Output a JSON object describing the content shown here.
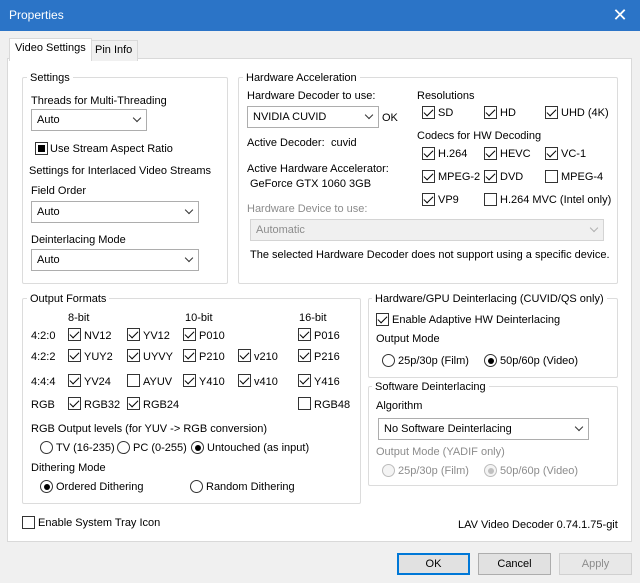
{
  "window": {
    "title": "Properties",
    "close": "✕"
  },
  "tabs": [
    "Video Settings",
    "Pin Info"
  ],
  "settings": {
    "legend": "Settings",
    "threads_label": "Threads for Multi-Threading",
    "threads_value": "Auto",
    "stream_aspect": "Use Stream Aspect Ratio",
    "interlaced_label": "Settings for Interlaced Video Streams",
    "field_order_label": "Field Order",
    "field_order_value": "Auto",
    "deint_mode_label": "Deinterlacing Mode",
    "deint_mode_value": "Auto"
  },
  "hw": {
    "legend": "Hardware Acceleration",
    "decoder_label": "Hardware Decoder to use:",
    "decoder_value": "NVIDIA CUVID",
    "decoder_status": "OK",
    "active_decoder_label": "Active Decoder:",
    "active_decoder_value": "cuvid",
    "active_accel_label": "Active Hardware Accelerator:",
    "active_accel_value": "GeForce GTX 1060 3GB",
    "device_label": "Hardware Device to use:",
    "device_value": "Automatic",
    "device_note": "The selected Hardware Decoder does not support using a specific device.",
    "resolutions_label": "Resolutions",
    "resolutions": [
      "SD",
      "HD",
      "UHD (4K)"
    ],
    "codecs_label": "Codecs for HW Decoding",
    "codecs": [
      "H.264",
      "HEVC",
      "VC-1",
      "MPEG-2",
      "DVD",
      "MPEG-4",
      "VP9",
      "H.264 MVC (Intel only)"
    ]
  },
  "output": {
    "legend": "Output Formats",
    "col_headers": [
      "8-bit",
      "10-bit",
      "16-bit"
    ],
    "row_labels": [
      "4:2:0",
      "4:2:2",
      "4:4:4",
      "RGB"
    ],
    "formats": [
      "NV12",
      "YV12",
      "P010",
      "P016",
      "YUY2",
      "UYVY",
      "P210",
      "v210",
      "P216",
      "YV24",
      "AYUV",
      "Y410",
      "v410",
      "Y416",
      "RGB32",
      "RGB24",
      "RGB48"
    ],
    "rgb_levels_label": "RGB Output levels (for YUV -> RGB conversion)",
    "rgb_levels": [
      "TV (16-235)",
      "PC (0-255)",
      "Untouched (as input)"
    ],
    "dither_label": "Dithering Mode",
    "dither": [
      "Ordered Dithering",
      "Random Dithering"
    ]
  },
  "hwdeint": {
    "legend": "Hardware/GPU Deinterlacing (CUVID/QS only)",
    "enable": "Enable Adaptive HW Deinterlacing",
    "mode_label": "Output Mode",
    "modes": [
      "25p/30p (Film)",
      "50p/60p (Video)"
    ]
  },
  "swdeint": {
    "legend": "Software Deinterlacing",
    "algo_label": "Algorithm",
    "algo_value": "No Software Deinterlacing",
    "mode_label": "Output Mode (YADIF only)",
    "modes": [
      "25p/30p (Film)",
      "50p/60p (Video)"
    ]
  },
  "tray": "Enable System Tray Icon",
  "version": "LAV Video Decoder 0.74.1.75-git",
  "buttons": {
    "ok": "OK",
    "cancel": "Cancel",
    "apply": "Apply"
  }
}
